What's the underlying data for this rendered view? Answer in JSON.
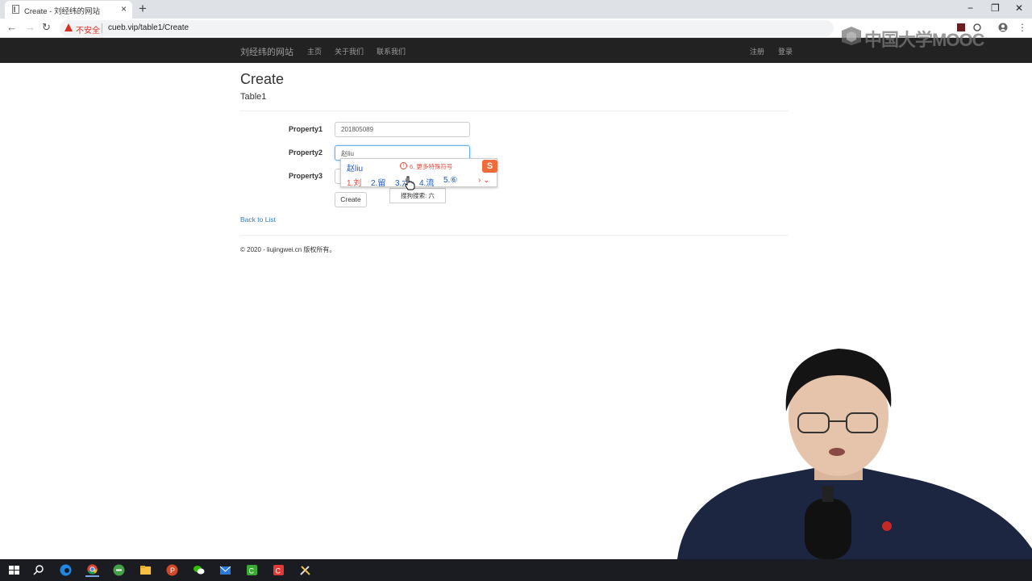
{
  "browser": {
    "tab_title": "Create - 刘经纬的网站",
    "tab_close": "×",
    "new_tab": "+",
    "insecure_label": "不安全",
    "url": "cueb.vip/table1/Create",
    "window_controls": {
      "minimize": "−",
      "restore": "❐",
      "close": "✕"
    },
    "nav": {
      "back": "←",
      "forward": "→",
      "reload": "↻"
    }
  },
  "watermark": {
    "text": "中国大学MOOC"
  },
  "site_nav": {
    "brand": "刘经纬的网站",
    "links": [
      "主页",
      "关于我们",
      "联系我们"
    ],
    "right_links": [
      "注册",
      "登录"
    ]
  },
  "page": {
    "title": "Create",
    "subtitle": "Table1",
    "form": {
      "fields": [
        {
          "label": "Property1",
          "value": "201805089"
        },
        {
          "label": "Property2",
          "value": "赵liu"
        },
        {
          "label": "Property3",
          "value": ""
        }
      ],
      "submit_label": "Create"
    },
    "back_link": "Back to List",
    "footer": "© 2020 - liujingwei.cn 版权所有。"
  },
  "ime": {
    "composition": "赵liu",
    "hint_icon": "!",
    "hint": "6. 更多特殊符号",
    "logo": "S",
    "candidates": [
      "1.刘",
      "2.留",
      "3.六",
      "4.流",
      "5.⑥"
    ],
    "pager": "› ⌄",
    "tooltip": "搜狗搜索: 六"
  },
  "colors": {
    "navbar_bg": "#222222",
    "link": "#337ab7",
    "ime_red": "#e24b3b",
    "ime_blue": "#1a56c6",
    "insecure_red": "#d93025"
  },
  "taskbar": {
    "apps": [
      "start-icon",
      "search-icon",
      "edge-icon",
      "chrome-icon",
      "green-browser-icon",
      "file-explorer-icon",
      "powerpoint-icon",
      "wechat-icon",
      "mail-icon",
      "camtasia-icon",
      "red-app-icon",
      "tools-icon"
    ]
  }
}
